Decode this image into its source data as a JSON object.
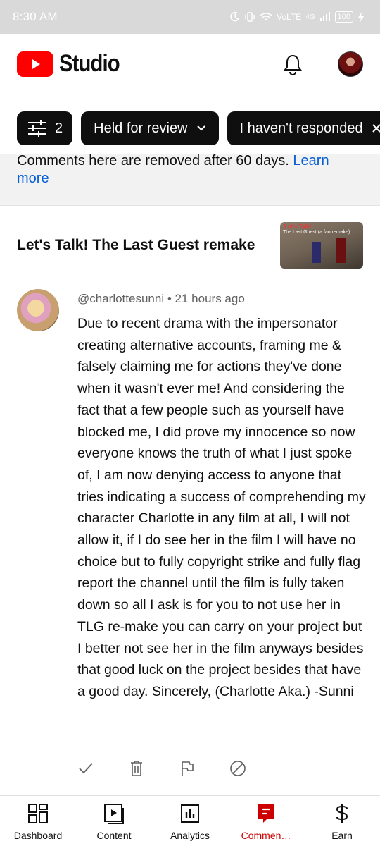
{
  "status_bar": {
    "time": "8:30 AM",
    "network": "VoLTE",
    "signal": "4G",
    "battery": "100"
  },
  "header": {
    "app_name": "Studio",
    "icons": [
      "notifications-bell-icon",
      "account-avatar"
    ]
  },
  "filters": {
    "filter_count": "2",
    "chips": [
      "Held for review",
      "I haven't responded"
    ]
  },
  "info_banner": {
    "text": "Comments here are removed after 60 days.",
    "link": "Learn more"
  },
  "video": {
    "title": "Let's Talk! The Last Guest remake",
    "thumbnail_text_1": "Let's Talk!",
    "thumbnail_text_2": "The Last Guest (a fan remake)"
  },
  "comment": {
    "author": "@charlottesunni",
    "separator": "•",
    "time": "21 hours ago",
    "text": "Due to recent drama with the impersonator creating alternative accounts, framing me & falsely claiming me for actions they've done when it wasn't ever me! And considering the fact that a few people such as yourself have blocked me, I did prove my innocence so now everyone knows the truth of what I just spoke of, I am now denying access to anyone that tries indicating a success of comprehending my character Charlotte in any film at all, I will not allow it, if I do see her in the film I will have no choice but to fully copyright strike and fully flag report the channel until the film is fully taken down so all I ask is for you to not use her in TLG re-make you can carry on your project but I better not see her in the film anyways besides that good luck on the project besides that have a good day. Sincerely, (Charlotte Aka.) -Sunni",
    "actions": [
      "approve-icon",
      "delete-icon",
      "report-flag-icon",
      "hide-user-icon"
    ]
  },
  "bottom_nav": {
    "items": [
      {
        "label": "Dashboard",
        "icon": "dashboard-icon"
      },
      {
        "label": "Content",
        "icon": "content-icon"
      },
      {
        "label": "Analytics",
        "icon": "analytics-icon"
      },
      {
        "label": "Commen…",
        "icon": "comments-icon",
        "active": true
      },
      {
        "label": "Earn",
        "icon": "earn-icon"
      }
    ]
  },
  "colors": {
    "brand_red": "#ff0000",
    "active_nav": "#cc0000",
    "link_blue": "#065fd4",
    "chip_bg": "#0f0f0f"
  }
}
